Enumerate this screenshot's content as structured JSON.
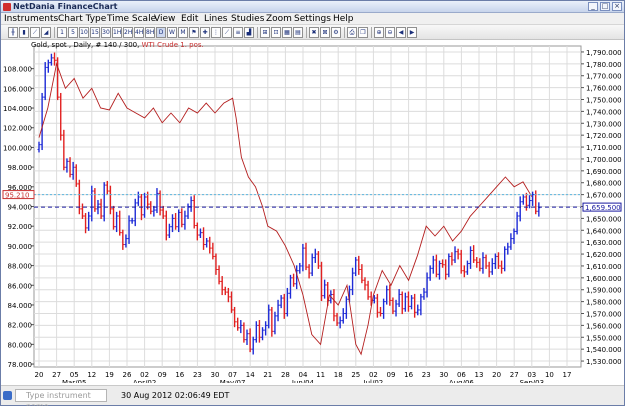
{
  "window": {
    "title": "NetDania FinanceChart"
  },
  "menu": [
    "Instruments",
    "Chart Type",
    "Time Scale",
    "View",
    "Edit",
    "Lines",
    "Studies",
    "Zoom",
    "Settings",
    "Help"
  ],
  "toolbar": {
    "period_buttons": [
      "1",
      "5",
      "10",
      "15",
      "30",
      "1H",
      "2H",
      "4H",
      "8H",
      "D",
      "W",
      "M"
    ]
  },
  "legend": {
    "gold": "Gold, spot , Daily, # 140 / 300,",
    "oil": "WTI Crude 1. pos."
  },
  "status": {
    "instrument_placeholder": "Type instrument name",
    "datetime": "30 Aug 2012 02:06:49 EDT"
  },
  "colors": {
    "up": "#1e2bd6",
    "down": "#e12020",
    "oil_line": "#b41e1e",
    "grid": "#dcdcdc",
    "cursor_line": "#1a1aa0",
    "oil_marker": "#5bb6e0"
  },
  "chart_data": {
    "type": "line",
    "left_axis": {
      "ticks": [
        78,
        80,
        82,
        84,
        86,
        88,
        90,
        92,
        94,
        96,
        98,
        100,
        102,
        104,
        106,
        108
      ],
      "labels": [
        "78.000",
        "80.000",
        "82.000",
        "84.000",
        "86.000",
        "88.000",
        "90.000",
        "92.000",
        "94.000",
        "96.000",
        "98.000",
        "100.000",
        "102.000",
        "104.000",
        "106.000",
        "108.000"
      ],
      "ylim": [
        77.7,
        110.3
      ],
      "marker": {
        "value": 95.21,
        "label": "95.210"
      }
    },
    "right_axis": {
      "ticks": [
        1530,
        1540,
        1550,
        1560,
        1570,
        1580,
        1590,
        1600,
        1610,
        1620,
        1630,
        1640,
        1650,
        1660,
        1670,
        1680,
        1690,
        1700,
        1710,
        1720,
        1730,
        1740,
        1750,
        1760,
        1770,
        1780,
        1790
      ],
      "labels": [
        "1,530.000",
        "1,540.000",
        "1,550.000",
        "1,560.000",
        "1,570.000",
        "1,580.000",
        "1,590.000",
        "1,600.000",
        "1,610.000",
        "1,620.000",
        "1,630.000",
        "1,640.000",
        "1,650.000",
        "1,660.000",
        "1,670.000",
        "1,680.000",
        "1,690.000",
        "1,700.000",
        "1,710.000",
        "1,720.000",
        "1,730.000",
        "1,740.000",
        "1,750.000",
        "1,760.000",
        "1,770.000",
        "1,780.000",
        "1,790.000"
      ],
      "ylim": [
        1525,
        1795
      ],
      "marker": {
        "value": 1659.5,
        "label": "1,659.500"
      }
    },
    "x_axis": {
      "day_labels": [
        "20",
        "27",
        "05",
        "12",
        "19",
        "26",
        "02",
        "09",
        "16",
        "23",
        "30",
        "07",
        "14",
        "21",
        "28",
        "04",
        "11",
        "18",
        "25",
        "02",
        "09",
        "16",
        "23",
        "30",
        "06",
        "13",
        "20",
        "27",
        "03",
        "10",
        "17"
      ],
      "month_labels": [
        {
          "label": "Mar/05",
          "index": 2
        },
        {
          "label": "Apr/02",
          "index": 6
        },
        {
          "label": "May/07",
          "index": 11
        },
        {
          "label": "Jun/04",
          "index": 15
        },
        {
          "label": "Jul/02",
          "index": 19
        },
        {
          "label": "Aug/06",
          "index": 24
        },
        {
          "label": "Sep/03",
          "index": 28
        }
      ]
    },
    "oil_series": {
      "name": "WTI Crude 1. pos.",
      "axis": "left",
      "points": [
        [
          0,
          101
        ],
        [
          0.5,
          104
        ],
        [
          1,
          108.5
        ],
        [
          1.5,
          106
        ],
        [
          2,
          107
        ],
        [
          2.5,
          105
        ],
        [
          3,
          106
        ],
        [
          3.5,
          104
        ],
        [
          4,
          103.8
        ],
        [
          4.5,
          105.5
        ],
        [
          5,
          104
        ],
        [
          5.5,
          103.5
        ],
        [
          6,
          103
        ],
        [
          6.5,
          104
        ],
        [
          7,
          102.5
        ],
        [
          7.5,
          103.5
        ],
        [
          8,
          102.5
        ],
        [
          8.5,
          104
        ],
        [
          9,
          103.5
        ],
        [
          9.5,
          104.5
        ],
        [
          10,
          103.5
        ],
        [
          10.5,
          104.5
        ],
        [
          11,
          105
        ],
        [
          11.2,
          103
        ],
        [
          11.5,
          99
        ],
        [
          11.9,
          97
        ],
        [
          12.3,
          96
        ],
        [
          12.7,
          94
        ],
        [
          13,
          92
        ],
        [
          13.5,
          91.5
        ],
        [
          14,
          90
        ],
        [
          14.5,
          88
        ],
        [
          15,
          85
        ],
        [
          15.5,
          81
        ],
        [
          16,
          80
        ],
        [
          16.5,
          85
        ],
        [
          17,
          84
        ],
        [
          17.5,
          86
        ],
        [
          18,
          80
        ],
        [
          18.3,
          79
        ],
        [
          18.7,
          82
        ],
        [
          19,
          85
        ],
        [
          19.5,
          87.5
        ],
        [
          20,
          86
        ],
        [
          20.5,
          88
        ],
        [
          21,
          86.5
        ],
        [
          21.5,
          89
        ],
        [
          22,
          92
        ],
        [
          22.5,
          91
        ],
        [
          23,
          92
        ],
        [
          23.5,
          90.5
        ],
        [
          24,
          91.5
        ],
        [
          24.5,
          93
        ],
        [
          25,
          94
        ],
        [
          25.5,
          95
        ],
        [
          26,
          96
        ],
        [
          26.5,
          97
        ],
        [
          27,
          96
        ],
        [
          27.5,
          96.5
        ],
        [
          28,
          95
        ]
      ]
    },
    "gold_series": {
      "name": "Gold",
      "axis": "right",
      "closes": [
        1712,
        1752,
        1777,
        1781,
        1785,
        1783,
        1752,
        1720,
        1693,
        1698,
        1687,
        1693,
        1679,
        1658,
        1652,
        1642,
        1652,
        1673,
        1658,
        1662,
        1652,
        1678,
        1673,
        1658,
        1643,
        1652,
        1638,
        1628,
        1633,
        1648,
        1648,
        1663,
        1668,
        1653,
        1668,
        1662,
        1656,
        1657,
        1671,
        1657,
        1652,
        1636,
        1643,
        1650,
        1643,
        1655,
        1645,
        1652,
        1660,
        1665,
        1644,
        1636,
        1638,
        1628,
        1631,
        1625,
        1618,
        1607,
        1597,
        1590,
        1588,
        1584,
        1573,
        1563,
        1558,
        1560,
        1548,
        1553,
        1540,
        1548,
        1560,
        1550,
        1556,
        1560,
        1573,
        1555,
        1568,
        1577,
        1583,
        1570,
        1587,
        1600,
        1595,
        1606,
        1610,
        1625,
        1609,
        1604,
        1617,
        1620,
        1610,
        1585,
        1594,
        1581,
        1586,
        1568,
        1562,
        1564,
        1570,
        1582,
        1590,
        1604,
        1615,
        1607,
        1598,
        1594,
        1584,
        1581,
        1583,
        1571,
        1570,
        1580,
        1590,
        1581,
        1572,
        1578,
        1586,
        1574,
        1584,
        1576,
        1583,
        1571,
        1573,
        1584,
        1588,
        1600,
        1608,
        1615,
        1603,
        1612,
        1611,
        1603,
        1618,
        1615,
        1622,
        1620,
        1606,
        1605,
        1612,
        1623,
        1615,
        1613,
        1608,
        1617,
        1610,
        1605,
        1612,
        1618,
        1610,
        1608,
        1624,
        1626,
        1633,
        1639,
        1652,
        1664,
        1668,
        1661,
        1665,
        1670,
        1656,
        1659
      ]
    }
  }
}
